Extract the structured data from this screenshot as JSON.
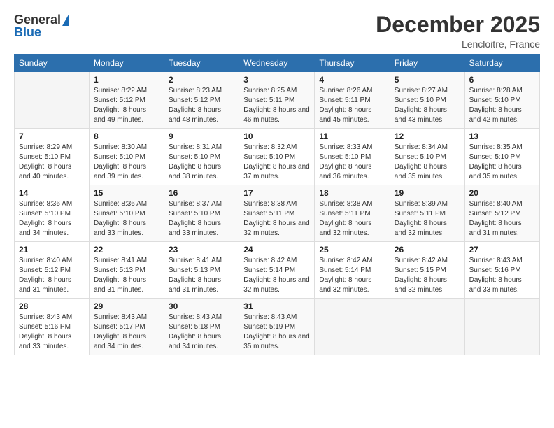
{
  "logo": {
    "general": "General",
    "blue": "Blue"
  },
  "header": {
    "month_title": "December 2025",
    "location": "Lencloitre, France"
  },
  "days_of_week": [
    "Sunday",
    "Monday",
    "Tuesday",
    "Wednesday",
    "Thursday",
    "Friday",
    "Saturday"
  ],
  "weeks": [
    [
      {
        "day": "",
        "sunrise": "",
        "sunset": "",
        "daylight": ""
      },
      {
        "day": "1",
        "sunrise": "Sunrise: 8:22 AM",
        "sunset": "Sunset: 5:12 PM",
        "daylight": "Daylight: 8 hours and 49 minutes."
      },
      {
        "day": "2",
        "sunrise": "Sunrise: 8:23 AM",
        "sunset": "Sunset: 5:12 PM",
        "daylight": "Daylight: 8 hours and 48 minutes."
      },
      {
        "day": "3",
        "sunrise": "Sunrise: 8:25 AM",
        "sunset": "Sunset: 5:11 PM",
        "daylight": "Daylight: 8 hours and 46 minutes."
      },
      {
        "day": "4",
        "sunrise": "Sunrise: 8:26 AM",
        "sunset": "Sunset: 5:11 PM",
        "daylight": "Daylight: 8 hours and 45 minutes."
      },
      {
        "day": "5",
        "sunrise": "Sunrise: 8:27 AM",
        "sunset": "Sunset: 5:10 PM",
        "daylight": "Daylight: 8 hours and 43 minutes."
      },
      {
        "day": "6",
        "sunrise": "Sunrise: 8:28 AM",
        "sunset": "Sunset: 5:10 PM",
        "daylight": "Daylight: 8 hours and 42 minutes."
      }
    ],
    [
      {
        "day": "7",
        "sunrise": "Sunrise: 8:29 AM",
        "sunset": "Sunset: 5:10 PM",
        "daylight": "Daylight: 8 hours and 40 minutes."
      },
      {
        "day": "8",
        "sunrise": "Sunrise: 8:30 AM",
        "sunset": "Sunset: 5:10 PM",
        "daylight": "Daylight: 8 hours and 39 minutes."
      },
      {
        "day": "9",
        "sunrise": "Sunrise: 8:31 AM",
        "sunset": "Sunset: 5:10 PM",
        "daylight": "Daylight: 8 hours and 38 minutes."
      },
      {
        "day": "10",
        "sunrise": "Sunrise: 8:32 AM",
        "sunset": "Sunset: 5:10 PM",
        "daylight": "Daylight: 8 hours and 37 minutes."
      },
      {
        "day": "11",
        "sunrise": "Sunrise: 8:33 AM",
        "sunset": "Sunset: 5:10 PM",
        "daylight": "Daylight: 8 hours and 36 minutes."
      },
      {
        "day": "12",
        "sunrise": "Sunrise: 8:34 AM",
        "sunset": "Sunset: 5:10 PM",
        "daylight": "Daylight: 8 hours and 35 minutes."
      },
      {
        "day": "13",
        "sunrise": "Sunrise: 8:35 AM",
        "sunset": "Sunset: 5:10 PM",
        "daylight": "Daylight: 8 hours and 35 minutes."
      }
    ],
    [
      {
        "day": "14",
        "sunrise": "Sunrise: 8:36 AM",
        "sunset": "Sunset: 5:10 PM",
        "daylight": "Daylight: 8 hours and 34 minutes."
      },
      {
        "day": "15",
        "sunrise": "Sunrise: 8:36 AM",
        "sunset": "Sunset: 5:10 PM",
        "daylight": "Daylight: 8 hours and 33 minutes."
      },
      {
        "day": "16",
        "sunrise": "Sunrise: 8:37 AM",
        "sunset": "Sunset: 5:10 PM",
        "daylight": "Daylight: 8 hours and 33 minutes."
      },
      {
        "day": "17",
        "sunrise": "Sunrise: 8:38 AM",
        "sunset": "Sunset: 5:11 PM",
        "daylight": "Daylight: 8 hours and 32 minutes."
      },
      {
        "day": "18",
        "sunrise": "Sunrise: 8:38 AM",
        "sunset": "Sunset: 5:11 PM",
        "daylight": "Daylight: 8 hours and 32 minutes."
      },
      {
        "day": "19",
        "sunrise": "Sunrise: 8:39 AM",
        "sunset": "Sunset: 5:11 PM",
        "daylight": "Daylight: 8 hours and 32 minutes."
      },
      {
        "day": "20",
        "sunrise": "Sunrise: 8:40 AM",
        "sunset": "Sunset: 5:12 PM",
        "daylight": "Daylight: 8 hours and 31 minutes."
      }
    ],
    [
      {
        "day": "21",
        "sunrise": "Sunrise: 8:40 AM",
        "sunset": "Sunset: 5:12 PM",
        "daylight": "Daylight: 8 hours and 31 minutes."
      },
      {
        "day": "22",
        "sunrise": "Sunrise: 8:41 AM",
        "sunset": "Sunset: 5:13 PM",
        "daylight": "Daylight: 8 hours and 31 minutes."
      },
      {
        "day": "23",
        "sunrise": "Sunrise: 8:41 AM",
        "sunset": "Sunset: 5:13 PM",
        "daylight": "Daylight: 8 hours and 31 minutes."
      },
      {
        "day": "24",
        "sunrise": "Sunrise: 8:42 AM",
        "sunset": "Sunset: 5:14 PM",
        "daylight": "Daylight: 8 hours and 32 minutes."
      },
      {
        "day": "25",
        "sunrise": "Sunrise: 8:42 AM",
        "sunset": "Sunset: 5:14 PM",
        "daylight": "Daylight: 8 hours and 32 minutes."
      },
      {
        "day": "26",
        "sunrise": "Sunrise: 8:42 AM",
        "sunset": "Sunset: 5:15 PM",
        "daylight": "Daylight: 8 hours and 32 minutes."
      },
      {
        "day": "27",
        "sunrise": "Sunrise: 8:43 AM",
        "sunset": "Sunset: 5:16 PM",
        "daylight": "Daylight: 8 hours and 33 minutes."
      }
    ],
    [
      {
        "day": "28",
        "sunrise": "Sunrise: 8:43 AM",
        "sunset": "Sunset: 5:16 PM",
        "daylight": "Daylight: 8 hours and 33 minutes."
      },
      {
        "day": "29",
        "sunrise": "Sunrise: 8:43 AM",
        "sunset": "Sunset: 5:17 PM",
        "daylight": "Daylight: 8 hours and 34 minutes."
      },
      {
        "day": "30",
        "sunrise": "Sunrise: 8:43 AM",
        "sunset": "Sunset: 5:18 PM",
        "daylight": "Daylight: 8 hours and 34 minutes."
      },
      {
        "day": "31",
        "sunrise": "Sunrise: 8:43 AM",
        "sunset": "Sunset: 5:19 PM",
        "daylight": "Daylight: 8 hours and 35 minutes."
      },
      {
        "day": "",
        "sunrise": "",
        "sunset": "",
        "daylight": ""
      },
      {
        "day": "",
        "sunrise": "",
        "sunset": "",
        "daylight": ""
      },
      {
        "day": "",
        "sunrise": "",
        "sunset": "",
        "daylight": ""
      }
    ]
  ]
}
